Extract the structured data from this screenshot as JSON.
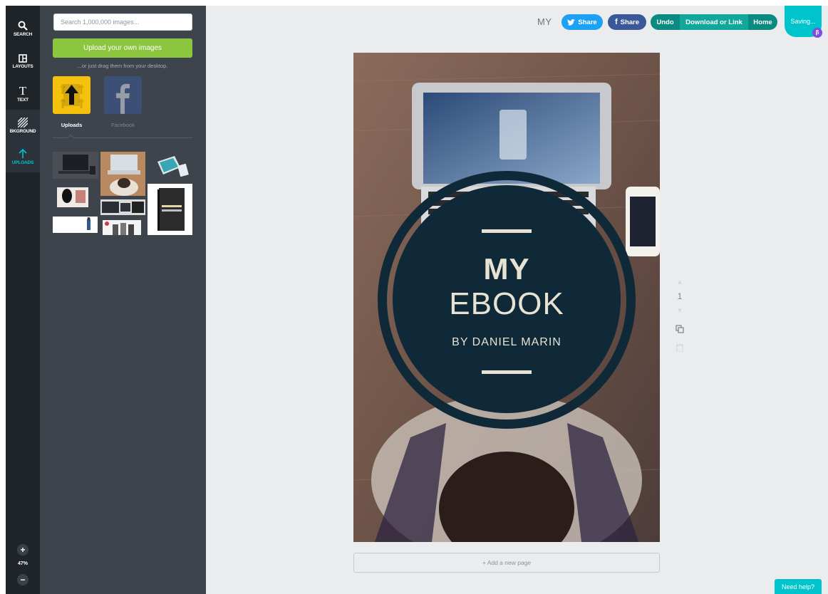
{
  "rail": {
    "items": [
      {
        "label": "SEARCH",
        "icon": "search-icon"
      },
      {
        "label": "LAYOUTS",
        "icon": "layouts-icon"
      },
      {
        "label": "TEXT",
        "icon": "text-icon"
      },
      {
        "label": "BKGROUND",
        "icon": "background-icon"
      },
      {
        "label": "UPLOADS",
        "icon": "upload-arrow-icon"
      }
    ],
    "zoom_in": "+",
    "zoom_level": "47%",
    "zoom_out": "−",
    "active_color": "#00c4cc"
  },
  "panel": {
    "search_placeholder": "Search 1,000,000 images...",
    "upload_button": "Upload your own images",
    "drag_hint": "...or just drag them from your desktop.",
    "sources": [
      {
        "label": "Uploads",
        "active": true
      },
      {
        "label": "Facebook",
        "active": false
      }
    ],
    "thumbnails_count": 8,
    "upload_button_color": "#8cc63f"
  },
  "header": {
    "doc_title": "MY",
    "twitter_share": "Share",
    "facebook_share": "Share",
    "undo": "Undo",
    "download": "Download or Link",
    "home": "Home",
    "saving": "Saving...",
    "beta": "β"
  },
  "cover": {
    "line1": "MY",
    "line2": "EBOOK",
    "author": "BY DANIEL MARIN",
    "circle_color": "#0f2938",
    "text_color": "#e8e2d3"
  },
  "page_controls": {
    "page_number": "1"
  },
  "footer": {
    "add_page": "+ Add a new page",
    "need_help": "Need help?"
  }
}
